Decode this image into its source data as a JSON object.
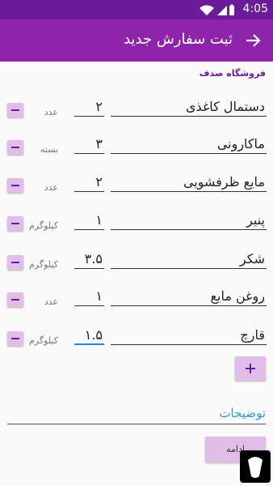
{
  "status_bar": {
    "time": "4:05",
    "color": "#6a1b9a"
  },
  "app_bar": {
    "title": "ثبت سفارش جدید",
    "color": "#8e24aa"
  },
  "store_name": "فروشگاه صدف",
  "items": [
    {
      "name": "دستمال کاغذی",
      "quantity": "۲",
      "unit": "عدد"
    },
    {
      "name": "ماکارونی",
      "quantity": "۳",
      "unit": "بسته"
    },
    {
      "name": "مایع ظرفشویی",
      "quantity": "۲",
      "unit": "عدد"
    },
    {
      "name": "پنیر",
      "quantity": "۱",
      "unit": "کیلوگرم"
    },
    {
      "name": "شکر",
      "quantity": "۳.۵",
      "unit": "کیلوگرم"
    },
    {
      "name": "روغن مایع",
      "quantity": "۱",
      "unit": "عدد"
    },
    {
      "name": "قارچ",
      "quantity": "۱.۵",
      "unit": "کیلوگرم"
    }
  ],
  "description_placeholder": "توضیحات",
  "continue_label": "ادامه",
  "colors": {
    "accent": "#8e24aa",
    "button_bg": "#e1bee7",
    "focus": "#1e88e5"
  }
}
